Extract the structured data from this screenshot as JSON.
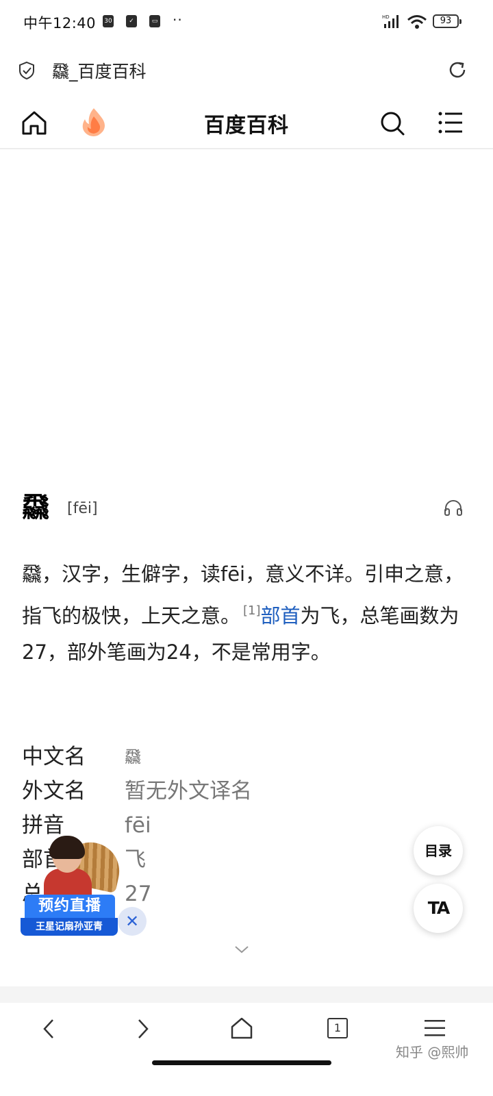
{
  "status_bar": {
    "time": "中午12:40",
    "app_icons": [
      "30",
      "✓",
      "▭"
    ],
    "more": "··",
    "signal_label": "HD",
    "battery": "93"
  },
  "address_bar": {
    "title": "飝_百度百科"
  },
  "site_header": {
    "title": "百度百科"
  },
  "entry": {
    "character": "飝",
    "pinyin": "[fēi]",
    "summary_part1": "飝，汉字，生僻字，读fēi，意义不详。引申之意，指飞的极快，上天之意。",
    "footnote": "[1]",
    "link_text": "部首",
    "summary_part2": "为飞，总笔画数为27，部外笔画为24，不是常用字。"
  },
  "basic_info": [
    {
      "label": "中文名",
      "value": "飝"
    },
    {
      "label": "外文名",
      "value": "暂无外文译名"
    },
    {
      "label": "拼音",
      "value": "fēi"
    },
    {
      "label": "部首",
      "value": "飞"
    },
    {
      "label": "总笔画",
      "value": "27"
    }
  ],
  "floating": {
    "toc_label": "目录",
    "ta_label": "TA"
  },
  "live_promo": {
    "badge": "预约直播",
    "subtitle": "王星记扇孙亚青",
    "close": "✕"
  },
  "bottom_nav": {
    "tabs_count": "1",
    "watermark": "知乎 @熙帅"
  }
}
